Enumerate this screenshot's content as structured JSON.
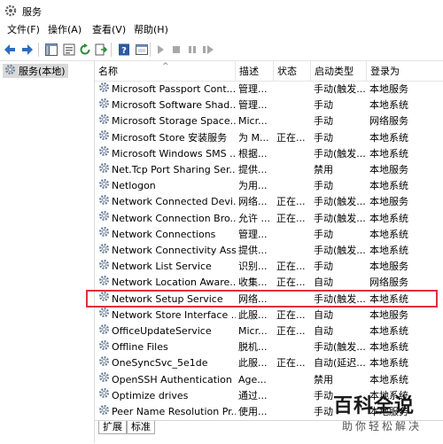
{
  "window": {
    "title": "服务"
  },
  "menu": [
    "文件(F)",
    "操作(A)",
    "查看(V)",
    "帮助(H)"
  ],
  "tree": {
    "root_label": "服务(本地)"
  },
  "columns": [
    "名称",
    "描述",
    "状态",
    "启动类型",
    "登录为"
  ],
  "services": [
    {
      "name": "Microsoft Passport Cont...",
      "desc": "管理...",
      "status": "",
      "startup": "手动(触发...",
      "logon": "本地服务"
    },
    {
      "name": "Microsoft Software Shad...",
      "desc": "管理...",
      "status": "",
      "startup": "手动",
      "logon": "本地系统"
    },
    {
      "name": "Microsoft Storage Space...",
      "desc": "Micr...",
      "status": "",
      "startup": "手动",
      "logon": "网络服务"
    },
    {
      "name": "Microsoft Store 安装服务",
      "desc": "为 M...",
      "status": "正在...",
      "startup": "手动",
      "logon": "本地系统"
    },
    {
      "name": "Microsoft Windows SMS ...",
      "desc": "根据...",
      "status": "",
      "startup": "手动(触发...",
      "logon": "本地系统"
    },
    {
      "name": "Net.Tcp Port Sharing Ser...",
      "desc": "提供...",
      "status": "",
      "startup": "禁用",
      "logon": "本地服务"
    },
    {
      "name": "Netlogon",
      "desc": "为用...",
      "status": "",
      "startup": "手动",
      "logon": "本地系统"
    },
    {
      "name": "Network Connected Devi...",
      "desc": "网络...",
      "status": "正在...",
      "startup": "手动(触发...",
      "logon": "本地服务"
    },
    {
      "name": "Network Connection Bro...",
      "desc": "允许 ...",
      "status": "正在...",
      "startup": "手动(触发...",
      "logon": "本地系统"
    },
    {
      "name": "Network Connections",
      "desc": "管理...",
      "status": "",
      "startup": "手动",
      "logon": "本地系统"
    },
    {
      "name": "Network Connectivity Ass...",
      "desc": "提供...",
      "status": "",
      "startup": "手动(触发...",
      "logon": "本地系统"
    },
    {
      "name": "Network List Service",
      "desc": "识别...",
      "status": "正在...",
      "startup": "手动",
      "logon": "本地服务"
    },
    {
      "name": "Network Location Aware...",
      "desc": "收集...",
      "status": "正在...",
      "startup": "自动",
      "logon": "网络服务"
    },
    {
      "name": "Network Setup Service",
      "desc": "网络...",
      "status": "",
      "startup": "手动(触发...",
      "logon": "本地系统"
    },
    {
      "name": "Network Store Interface ...",
      "desc": "此服...",
      "status": "正在...",
      "startup": "自动",
      "logon": "本地服务"
    },
    {
      "name": "OfficeUpdateService",
      "desc": "Micr...",
      "status": "正在...",
      "startup": "自动",
      "logon": "本地系统"
    },
    {
      "name": "Offline Files",
      "desc": "脱机...",
      "status": "",
      "startup": "手动(触发...",
      "logon": "本地系统"
    },
    {
      "name": "OneSyncSvc_5e1de",
      "desc": "此服...",
      "status": "正在...",
      "startup": "自动(延迟...",
      "logon": "本地系统"
    },
    {
      "name": "OpenSSH Authentication ...",
      "desc": "Age...",
      "status": "",
      "startup": "禁用",
      "logon": "本地系统"
    },
    {
      "name": "Optimize drives",
      "desc": "通过...",
      "status": "",
      "startup": "手动",
      "logon": "本地系统"
    },
    {
      "name": "Peer Name Resolution Pr...",
      "desc": "使用...",
      "status": "",
      "startup": "手动",
      "logon": "本地服务"
    }
  ],
  "tabs": [
    "扩展",
    "标准"
  ],
  "watermark": {
    "big": "百科全说",
    "small": "助你轻松解决"
  }
}
